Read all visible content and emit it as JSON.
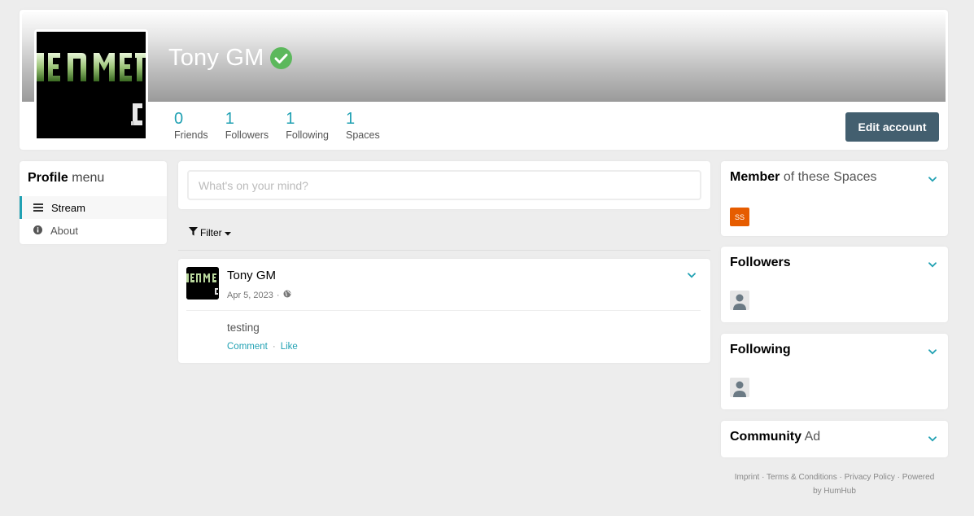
{
  "profile": {
    "name": "Tony GM",
    "stats": [
      {
        "value": "0",
        "label": "Friends"
      },
      {
        "value": "1",
        "label": "Followers"
      },
      {
        "value": "1",
        "label": "Following"
      },
      {
        "value": "1",
        "label": "Spaces"
      }
    ],
    "edit_label": "Edit account",
    "verified_color": "#5cb85c"
  },
  "profile_menu": {
    "title_bold": "Profile",
    "title_light": "menu",
    "items": [
      {
        "label": "Stream",
        "icon": "list-icon"
      },
      {
        "label": "About",
        "icon": "info-icon"
      }
    ]
  },
  "stream": {
    "post_placeholder": "What's on your mind?",
    "filter_label": "Filter",
    "post": {
      "author": "Tony GM",
      "date": "Apr 5, 2023",
      "separator": "·",
      "body": "testing",
      "comment_label": "Comment",
      "action_sep": "·",
      "like_label": "Like"
    }
  },
  "sidebar": {
    "spaces": {
      "title_bold": "Member",
      "title_light": "of these Spaces",
      "space_badge": "SS",
      "badge_color": "#e65c00"
    },
    "followers": {
      "title_bold": "Followers"
    },
    "following": {
      "title_bold": "Following"
    },
    "ad": {
      "title_bold": "Community",
      "title_light": "Ad"
    }
  },
  "footer": {
    "links": [
      "Imprint",
      "Terms & Conditions",
      "Privacy Policy"
    ],
    "sep": "·",
    "powered": "Powered",
    "by": "by HumHub"
  },
  "colors": {
    "accent": "#21a1b3",
    "primary": "#435f6f",
    "background": "#ededed"
  }
}
